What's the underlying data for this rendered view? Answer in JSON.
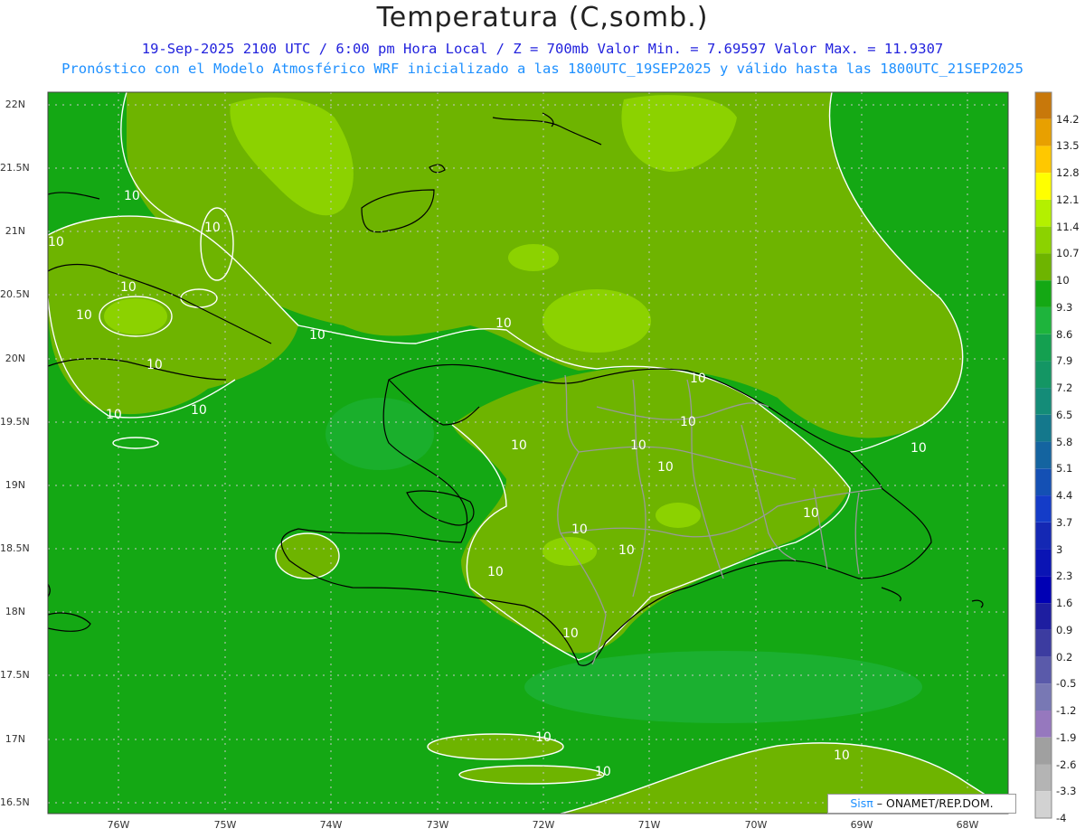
{
  "title": "Temperatura (C,somb.)",
  "subtitle_line1": "19-Sep-2025  2100 UTC / 6:00 pm Hora Local / Z = 700mb    Valor Min. = 7.69597  Valor Max. = 11.9307",
  "subtitle_line2": "Pronóstico con el Modelo Atmosférico WRF inicializado a las 1800UTC_19SEP2025 y válido hasta las  1800UTC_21SEP2025",
  "lat_labels": [
    "22N",
    "21.5N",
    "21N",
    "20.5N",
    "20N",
    "19.5N",
    "19N",
    "18.5N",
    "18N",
    "17.5N",
    "17N",
    "16.5N"
  ],
  "lon_labels": [
    "76W",
    "75W",
    "74W",
    "73W",
    "72W",
    "71W",
    "70W",
    "69W",
    "68W"
  ],
  "contour_label": "10",
  "credit": {
    "sis": "Sisπ",
    "rest": " – ONAMET/REP.DOM."
  },
  "colorbar": [
    {
      "label": "14.2",
      "color": "#c8780a"
    },
    {
      "label": "13.5",
      "color": "#e8a000"
    },
    {
      "label": "12.8",
      "color": "#ffc800"
    },
    {
      "label": "12.1",
      "color": "#ffff00"
    },
    {
      "label": "11.4",
      "color": "#b4f000"
    },
    {
      "label": "10.7",
      "color": "#8cd200"
    },
    {
      "label": "10",
      "color": "#6eb400"
    },
    {
      "label": "9.3",
      "color": "#14a814"
    },
    {
      "label": "8.6",
      "color": "#1eb43c"
    },
    {
      "label": "7.9",
      "color": "#14a050"
    },
    {
      "label": "7.2",
      "color": "#149664"
    },
    {
      "label": "6.5",
      "color": "#148c78"
    },
    {
      "label": "5.8",
      "color": "#14788c"
    },
    {
      "label": "5.1",
      "color": "#1464a0"
    },
    {
      "label": "4.4",
      "color": "#1450b4"
    },
    {
      "label": "3.7",
      "color": "#143cc8"
    },
    {
      "label": "3",
      "color": "#1428b4"
    },
    {
      "label": "2.3",
      "color": "#0a14b4"
    },
    {
      "label": "1.6",
      "color": "#0000b4"
    },
    {
      "label": "0.9",
      "color": "#1e1ea0"
    },
    {
      "label": "0.2",
      "color": "#3c3ca0"
    },
    {
      "label": "-0.5",
      "color": "#5a5aaa"
    },
    {
      "label": "-1.2",
      "color": "#7878b4"
    },
    {
      "label": "-1.9",
      "color": "#9678be"
    },
    {
      "label": "-2.6",
      "color": "#a0a0a0"
    },
    {
      "label": "-3.3",
      "color": "#b4b4b4"
    },
    {
      "label": "-4",
      "color": "#d2d2d2"
    }
  ],
  "colors": {
    "field_base": "#14a814",
    "field_warm": "#6eb400",
    "field_warmer": "#8cd200",
    "field_cool": "#1eb43c",
    "contour": "#ffffff",
    "coast": "#000000",
    "border": "#999999"
  }
}
